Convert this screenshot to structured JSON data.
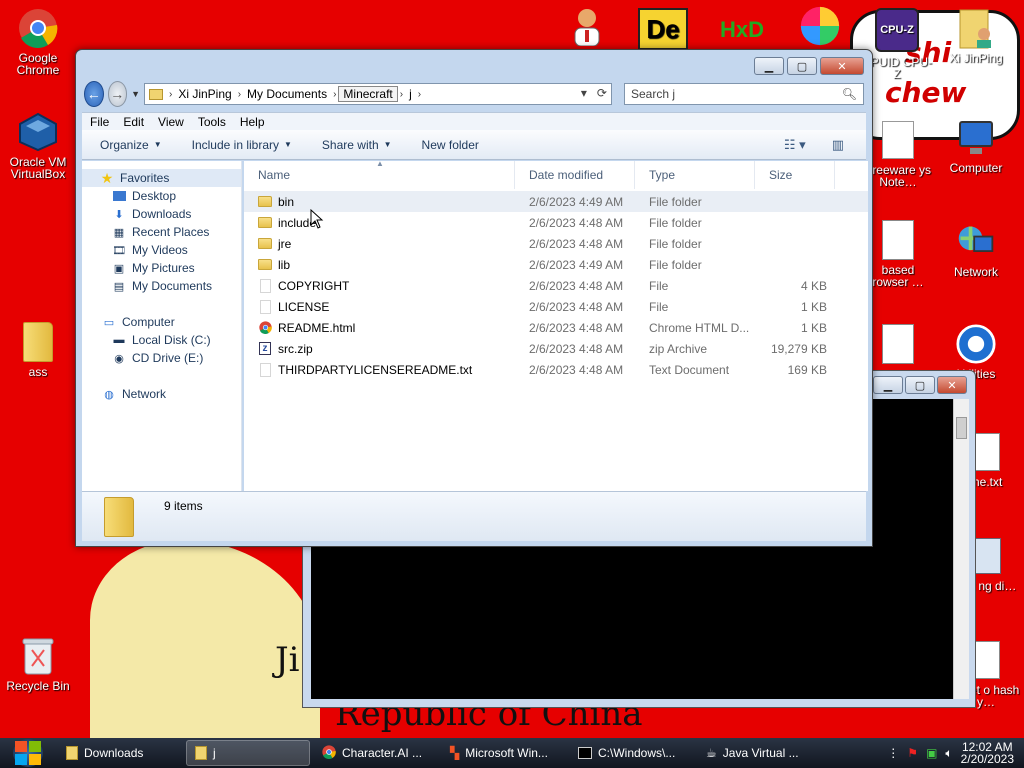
{
  "desktop": {
    "icons_left": [
      {
        "label": "Google Chrome",
        "icon": "chrome-icon"
      },
      {
        "label": "Oracle VM VirtualBox",
        "icon": "virtualbox-icon"
      },
      {
        "label": "ass",
        "icon": "folder-icon"
      },
      {
        "label": "Recycle Bin",
        "icon": "recycle-bin-icon"
      }
    ],
    "icons_top": [
      {
        "label": "CPUID CPU-Z",
        "icon": "cpuz-icon"
      },
      {
        "label": "Xi JinPing",
        "icon": "user-folder-icon"
      }
    ],
    "icons_right": [
      {
        "label": "Freeware ys Note…",
        "icon": "notes-icon"
      },
      {
        "label": "Computer",
        "icon": "computer-icon"
      },
      {
        "label": "based rowser …",
        "icon": "browser-doc-icon"
      },
      {
        "label": "Network",
        "icon": "network-icon"
      },
      {
        "label": "Utilities",
        "icon": "utilities-icon"
      },
      {
        "label": "me.txt",
        "icon": "text-file-icon"
      },
      {
        "label": "aint ng di…",
        "icon": "paint-icon"
      },
      {
        "label": "orget o hash y…",
        "icon": "doc-icon"
      }
    ],
    "wallpaper_text": {
      "shi": "shi",
      "chew": "chew",
      "republic": "Republic of China",
      "ji": "Ji"
    }
  },
  "explorer": {
    "breadcrumb": [
      "Xi JinPing",
      "My Documents",
      "Minecraft",
      "j"
    ],
    "search_placeholder": "Search j",
    "menu": [
      "File",
      "Edit",
      "View",
      "Tools",
      "Help"
    ],
    "toolbar": {
      "organize": "Organize",
      "include": "Include in library",
      "share": "Share with",
      "new_folder": "New folder"
    },
    "nav": {
      "favorites": "Favorites",
      "desktop": "Desktop",
      "downloads": "Downloads",
      "recent": "Recent Places",
      "videos": "My Videos",
      "pictures": "My Pictures",
      "documents": "My Documents",
      "computer": "Computer",
      "local_disk": "Local Disk (C:)",
      "cd_drive": "CD Drive (E:)",
      "network": "Network"
    },
    "columns": {
      "name": "Name",
      "date": "Date modified",
      "type": "Type",
      "size": "Size"
    },
    "files": [
      {
        "name": "bin",
        "date": "2/6/2023 4:49 AM",
        "type": "File folder",
        "size": "",
        "icon": "folder"
      },
      {
        "name": "include",
        "date": "2/6/2023 4:48 AM",
        "type": "File folder",
        "size": "",
        "icon": "folder"
      },
      {
        "name": "jre",
        "date": "2/6/2023 4:48 AM",
        "type": "File folder",
        "size": "",
        "icon": "folder"
      },
      {
        "name": "lib",
        "date": "2/6/2023 4:49 AM",
        "type": "File folder",
        "size": "",
        "icon": "folder"
      },
      {
        "name": "COPYRIGHT",
        "date": "2/6/2023 4:48 AM",
        "type": "File",
        "size": "4 KB",
        "icon": "file"
      },
      {
        "name": "LICENSE",
        "date": "2/6/2023 4:48 AM",
        "type": "File",
        "size": "1 KB",
        "icon": "file"
      },
      {
        "name": "README.html",
        "date": "2/6/2023 4:48 AM",
        "type": "Chrome HTML D...",
        "size": "1 KB",
        "icon": "chrome"
      },
      {
        "name": "src.zip",
        "date": "2/6/2023 4:48 AM",
        "type": "zip Archive",
        "size": "19,279 KB",
        "icon": "zip"
      },
      {
        "name": "THIRDPARTYLICENSEREADME.txt",
        "date": "2/6/2023 4:48 AM",
        "type": "Text Document",
        "size": "169 KB",
        "icon": "file"
      }
    ],
    "status": "9 items"
  },
  "taskbar": {
    "items": [
      {
        "label": "Downloads",
        "icon": "folder-icon"
      },
      {
        "label": "j",
        "icon": "folder-icon"
      },
      {
        "label": "Character.AI ...",
        "icon": "chrome-icon"
      },
      {
        "label": "Microsoft Win...",
        "icon": "windows-installer-icon"
      },
      {
        "label": "C:\\Windows\\...",
        "icon": "console-icon"
      },
      {
        "label": "Java Virtual ...",
        "icon": "java-icon"
      }
    ],
    "time": "12:02 AM",
    "date": "2/20/2023"
  }
}
